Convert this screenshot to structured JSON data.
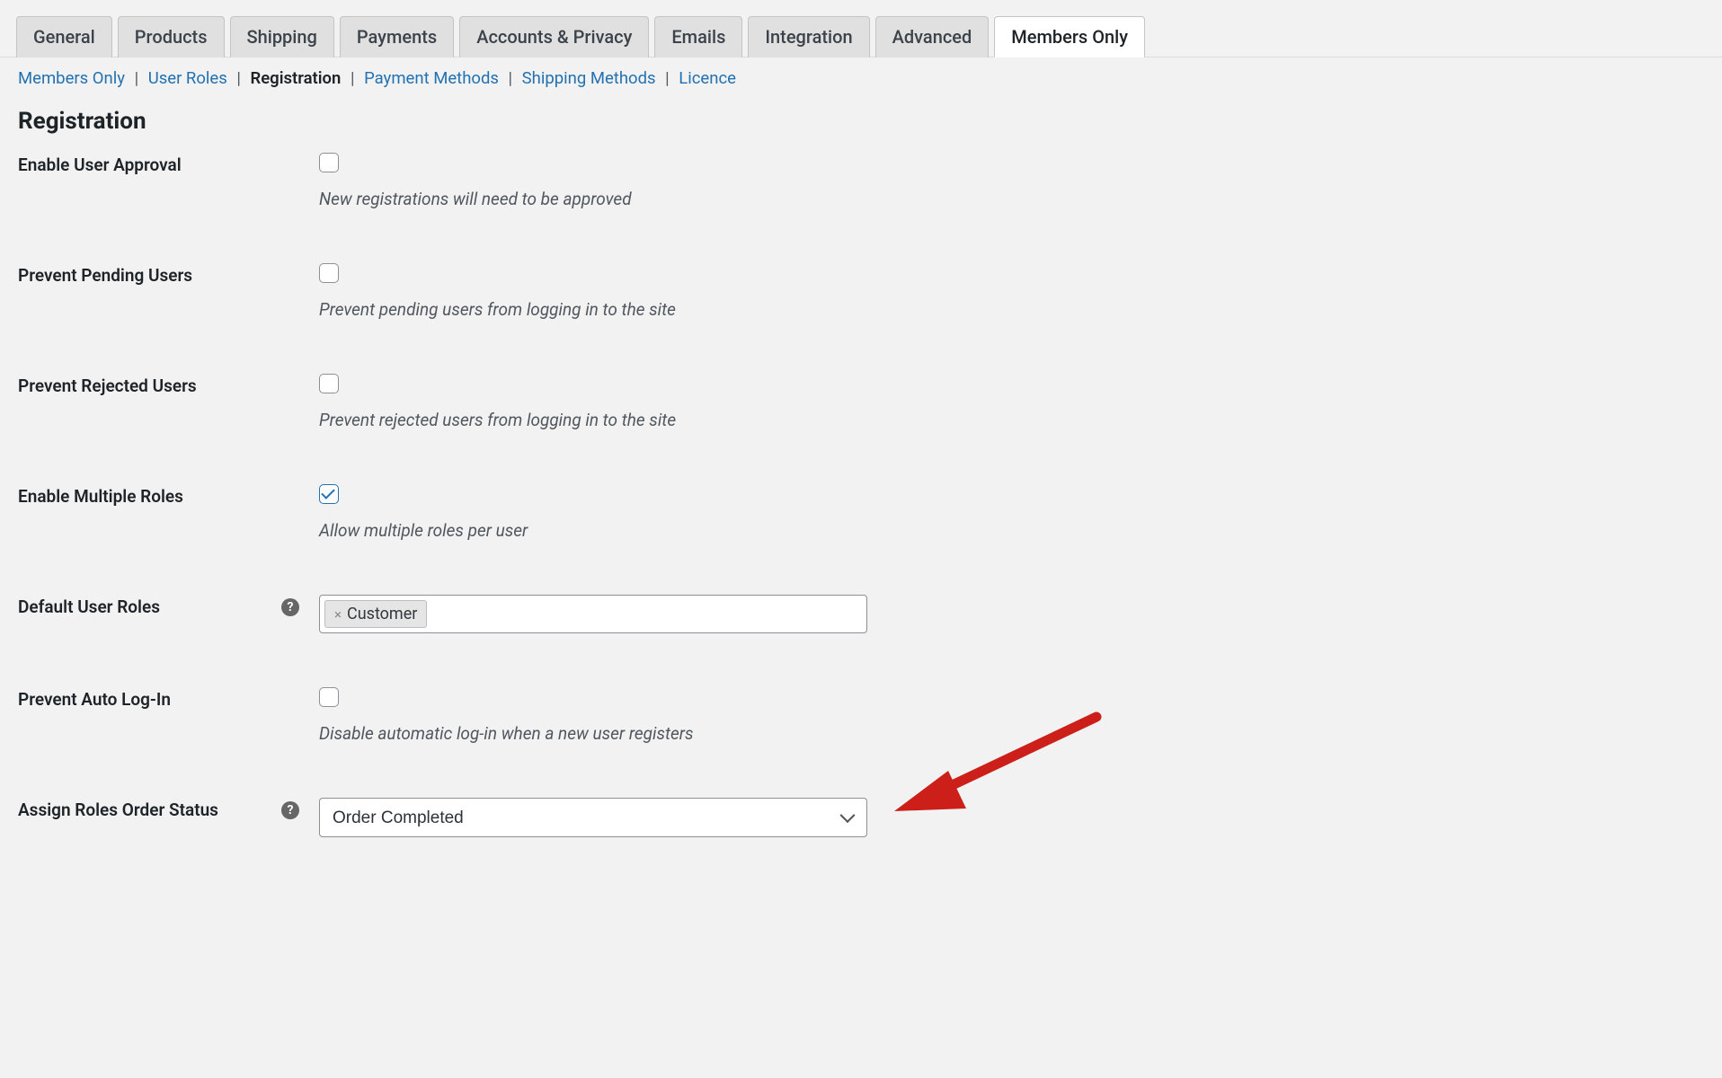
{
  "tabs": {
    "items": [
      {
        "label": "General"
      },
      {
        "label": "Products"
      },
      {
        "label": "Shipping"
      },
      {
        "label": "Payments"
      },
      {
        "label": "Accounts & Privacy"
      },
      {
        "label": "Emails"
      },
      {
        "label": "Integration"
      },
      {
        "label": "Advanced"
      },
      {
        "label": "Members Only",
        "active": true
      }
    ]
  },
  "subnav": {
    "items": [
      {
        "label": "Members Only",
        "link": true
      },
      {
        "label": "User Roles",
        "link": true
      },
      {
        "label": "Registration",
        "link": false,
        "current": true
      },
      {
        "label": "Payment Methods",
        "link": true
      },
      {
        "label": "Shipping Methods",
        "link": true
      },
      {
        "label": "Licence",
        "link": true
      }
    ]
  },
  "section_title": "Registration",
  "fields": {
    "enable_user_approval": {
      "label": "Enable User Approval",
      "description": "New registrations will need to be approved"
    },
    "prevent_pending": {
      "label": "Prevent Pending Users",
      "description": "Prevent pending users from logging in to the site"
    },
    "prevent_rejected": {
      "label": "Prevent Rejected Users",
      "description": "Prevent rejected users from logging in to the site"
    },
    "enable_multiple_roles": {
      "label": "Enable Multiple Roles",
      "description": "Allow multiple roles per user"
    },
    "default_user_roles": {
      "label": "Default User Roles",
      "tags": [
        "Customer"
      ]
    },
    "prevent_auto_login": {
      "label": "Prevent Auto Log-In",
      "description": "Disable automatic log-in when a new user registers"
    },
    "assign_roles_order_status": {
      "label": "Assign Roles Order Status",
      "value": "Order Completed"
    }
  }
}
